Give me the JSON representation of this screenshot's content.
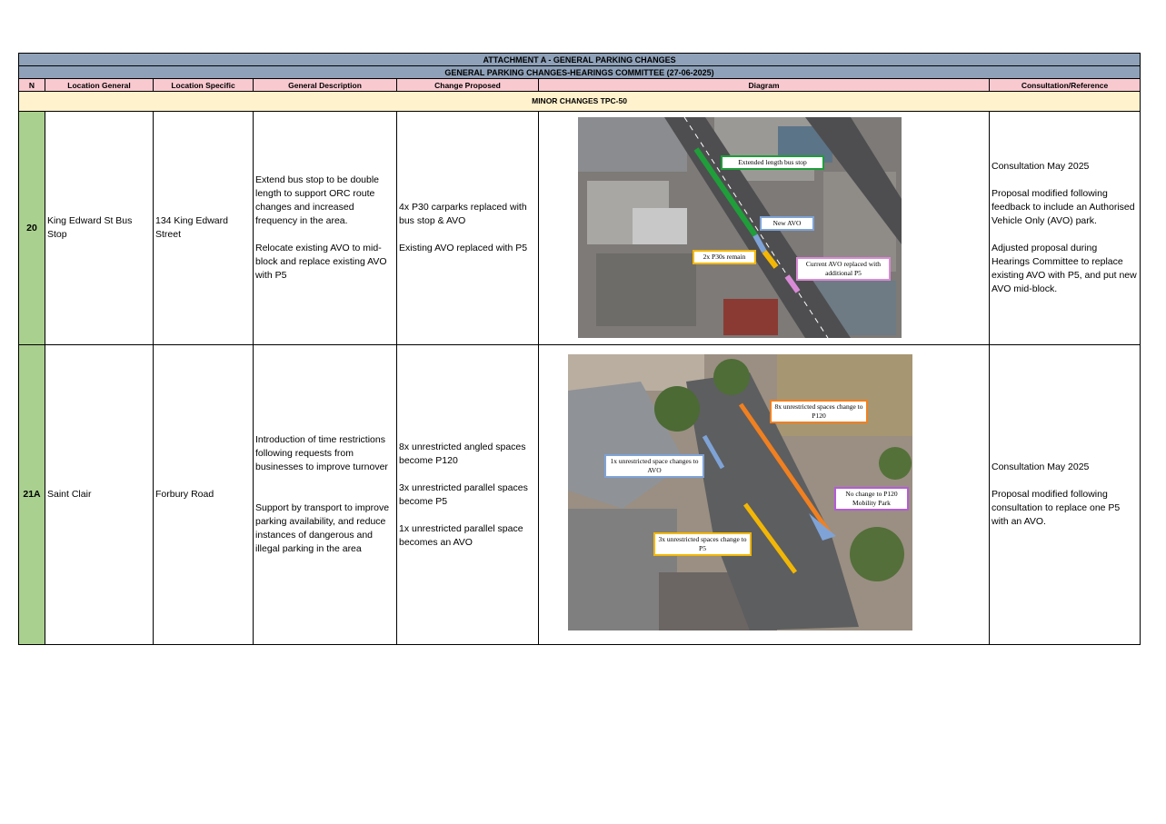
{
  "title": "ATTACHMENT A - GENERAL PARKING CHANGES",
  "subtitle": "GENERAL PARKING CHANGES-HEARINGS COMMITTEE (27-06-2025)",
  "columns": [
    "N",
    "Location General",
    "Location Specific",
    "General Description",
    "Change Proposed",
    "Diagram",
    "Consultation/Reference"
  ],
  "section": "MINOR CHANGES TPC-50",
  "rows": [
    {
      "n": "20",
      "location_general": "King Edward St Bus Stop",
      "location_specific": "134 King Edward Street",
      "description": "Extend bus stop to be double length to support ORC route changes and increased frequency in the area.\n\nRelocate existing AVO to mid-block and replace existing AVO with P5",
      "change": "4x P30 carparks replaced with bus stop & AVO\n\nExisting AVO replaced with P5",
      "diagram_labels": [
        "Extended length bus stop",
        "New AVO",
        "2x P30s remain",
        "Current AVO replaced with additional P5"
      ],
      "consultation": "Consultation May 2025\n\nProposal modified following feedback to include an Authorised Vehicle Only (AVO) park.\n\nAdjusted proposal during Hearings Committee to replace existing AVO with P5, and put new AVO mid-block."
    },
    {
      "n": "21A",
      "location_general": "Saint Clair",
      "location_specific": "Forbury Road",
      "description": "Introduction of time restrictions following requests from businesses to improve turnover\n\n\nSupport by transport to improve parking availability, and reduce instances of dangerous and illegal parking in the area",
      "change": "8x unrestricted angled spaces become P120\n\n3x unrestricted parallel spaces become P5\n\n1x unrestricted parallel space becomes an AVO",
      "diagram_labels": [
        "8x unrestricted spaces change to P120",
        "1x unrestricted space changes to AVO",
        "No change to P120 Mobility Park",
        "3x unrestricted spaces change to P5"
      ],
      "consultation": "Consultation May 2025\n\nProposal modified following consultation to replace one P5 with an AVO."
    }
  ],
  "colors": {
    "title_bg": "#8ea1b8",
    "header_bg": "#f9c9d0",
    "section_bg": "#fff2cc",
    "number_bg": "#a9d08e",
    "green": "#1f9e3a",
    "blue": "#7fa3d6",
    "orange": "#f08020",
    "yellow": "#f2b705",
    "pink": "#d98ad6",
    "purple": "#b45cd8"
  }
}
